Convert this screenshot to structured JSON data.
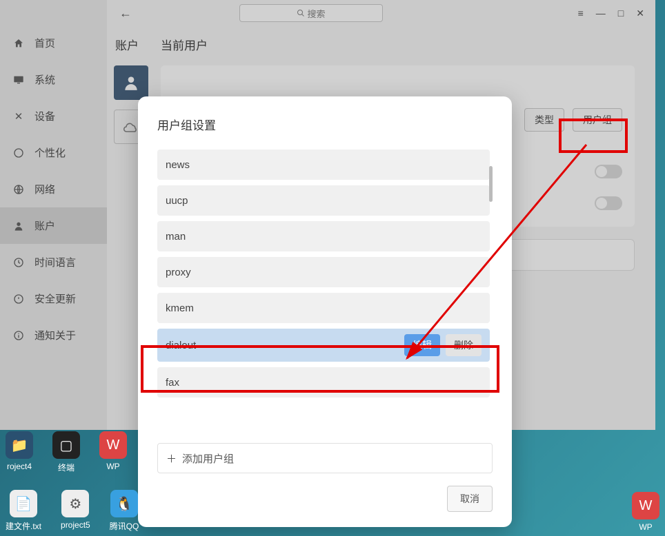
{
  "sidebar": {
    "items": [
      {
        "label": "首页",
        "icon": "home"
      },
      {
        "label": "系统",
        "icon": "monitor"
      },
      {
        "label": "设备",
        "icon": "cross"
      },
      {
        "label": "个性化",
        "icon": "globe"
      },
      {
        "label": "网络",
        "icon": "globe2"
      },
      {
        "label": "账户",
        "icon": "user"
      },
      {
        "label": "时间语言",
        "icon": "clock"
      },
      {
        "label": "安全更新",
        "icon": "shield"
      },
      {
        "label": "通知关于",
        "icon": "info"
      }
    ],
    "active_index": 5
  },
  "topbar": {
    "search_placeholder": "搜索"
  },
  "content": {
    "accounts_title": "账户",
    "details_title": "当前用户",
    "type_chip": "类型",
    "group_chip": "用户组"
  },
  "modal": {
    "title": "用户组设置",
    "groups": [
      "news",
      "uucp",
      "man",
      "proxy",
      "kmem",
      "dialout",
      "fax"
    ],
    "selected_index": 5,
    "edit_label": "编辑",
    "delete_label": "删除",
    "add_label": "添加用户组",
    "cancel_label": "取消"
  },
  "desktop": {
    "row1": [
      "roject4",
      "终端",
      "WP"
    ],
    "row2": [
      "建文件.txt",
      "project5",
      "腾讯QQ"
    ],
    "right": "WP"
  }
}
